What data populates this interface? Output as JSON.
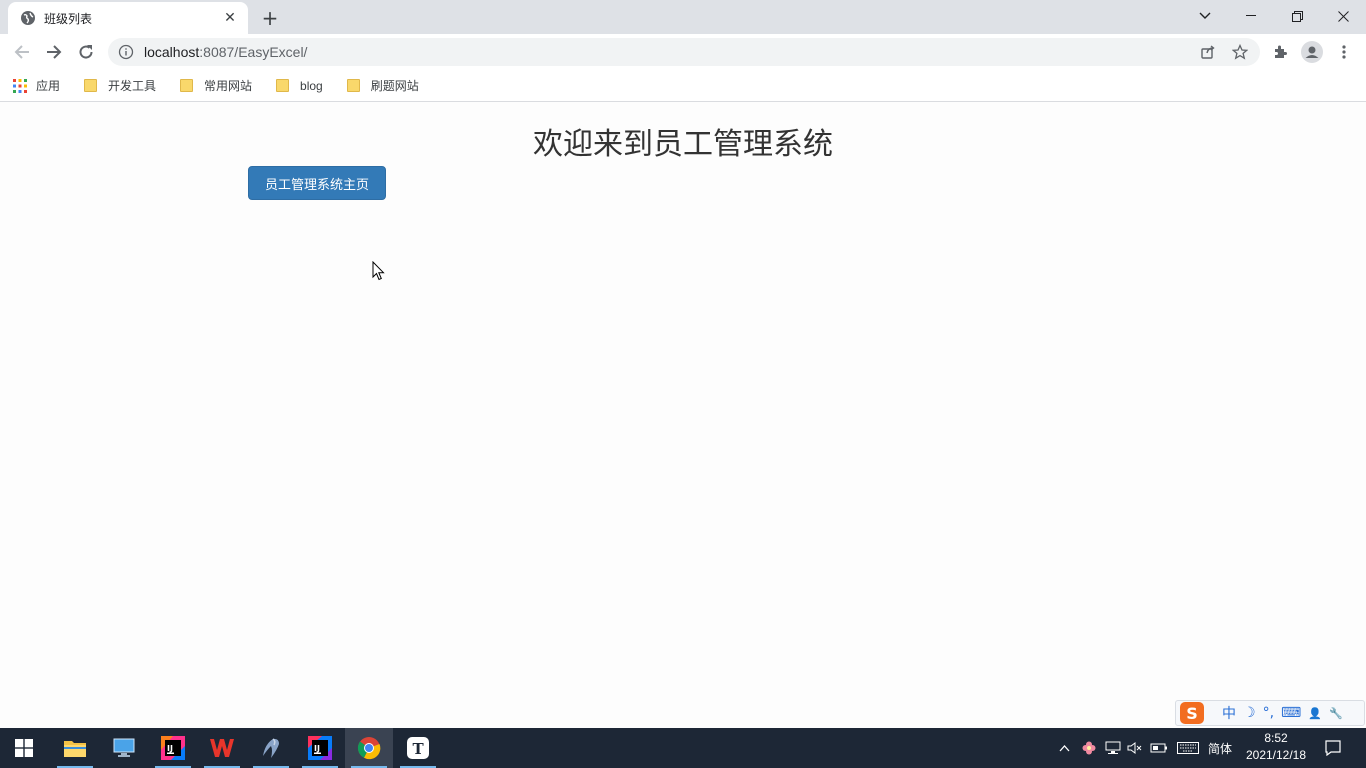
{
  "browser": {
    "tab_title": "班级列表",
    "url_host": "localhost",
    "url_rest": ":8087/EasyExcel/",
    "bookmarks": [
      {
        "label": "应用",
        "icon": "apps-grid-icon"
      },
      {
        "label": "开发工具",
        "icon": "folder-icon"
      },
      {
        "label": "常用网站",
        "icon": "folder-icon"
      },
      {
        "label": "blog",
        "icon": "folder-icon"
      },
      {
        "label": "刷题网站",
        "icon": "folder-icon"
      }
    ]
  },
  "page": {
    "heading": "欢迎来到员工管理系统",
    "main_button": "员工管理系统主页",
    "button_color": "#337ab7"
  },
  "ime": {
    "logo": "S",
    "items": [
      "中",
      "☽",
      "°,",
      "⌨",
      "👤",
      "🔧"
    ]
  },
  "taskbar": {
    "language": "简体",
    "time": "8:52",
    "date": "2021/12/18",
    "apps": [
      "windows-start-icon",
      "file-explorer-icon",
      "this-pc-icon",
      "intellij-ultimate-icon",
      "wps-office-icon",
      "mysql-dolphin-icon",
      "intellij-idea-icon",
      "chrome-icon",
      "typora-icon"
    ]
  }
}
